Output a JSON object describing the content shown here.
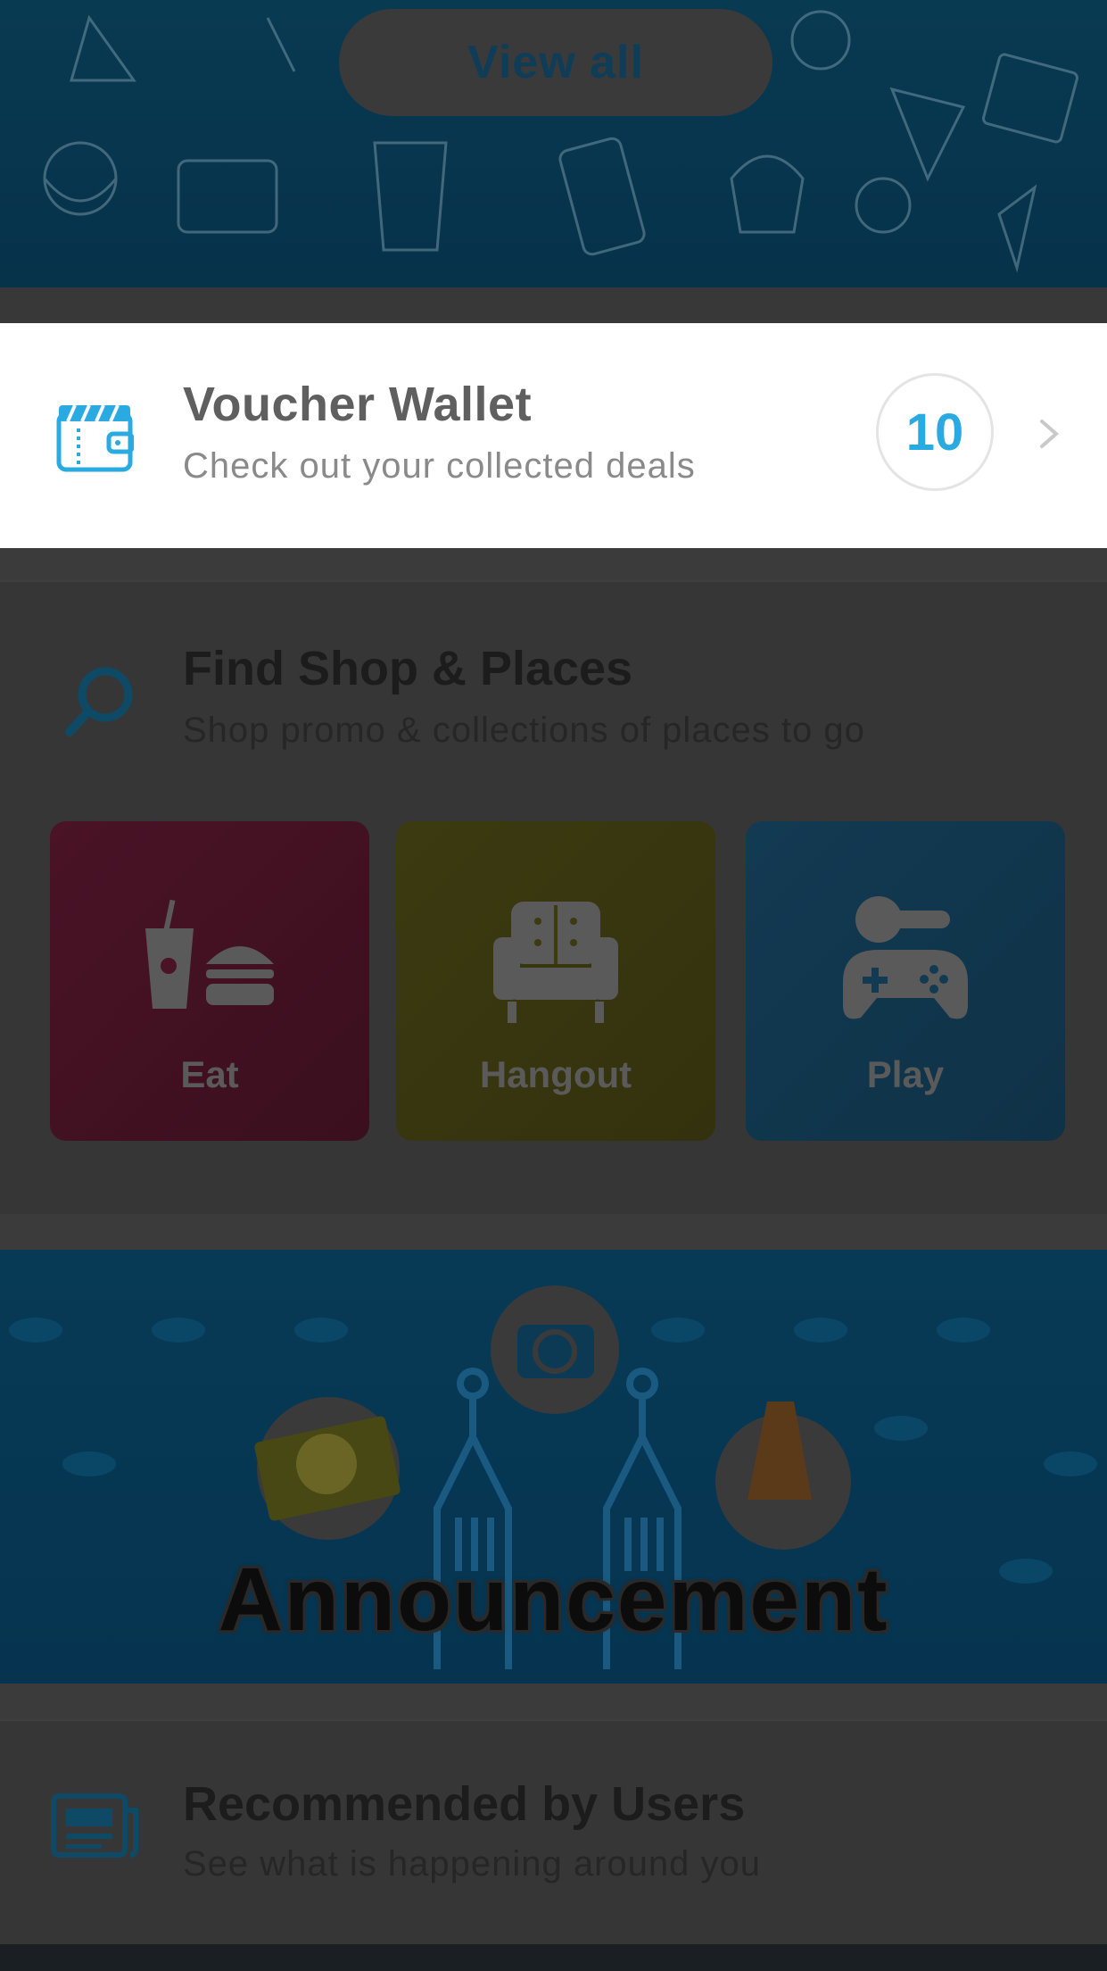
{
  "banner_top": {
    "view_all_label": "View all"
  },
  "voucher_wallet": {
    "title": "Voucher Wallet",
    "subtitle": "Check out your collected deals",
    "count": "10",
    "icon": "wallet-icon",
    "accent": "#29abe2"
  },
  "find_shop": {
    "title": "Find Shop & Places",
    "subtitle": "Shop promo & collections of places to go",
    "icon": "search-icon",
    "tiles": [
      {
        "label": "Eat",
        "icon": "food-icon"
      },
      {
        "label": "Hangout",
        "icon": "sofa-icon"
      },
      {
        "label": "Play",
        "icon": "game-icon"
      }
    ]
  },
  "announcement": {
    "text": "Announcement"
  },
  "recommended": {
    "title": "Recommended by Users",
    "subtitle": "See what is happening around you",
    "icon": "newspaper-icon"
  }
}
